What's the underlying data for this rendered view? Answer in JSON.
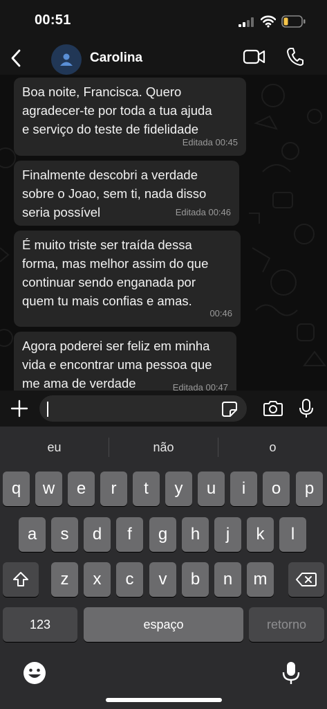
{
  "status_bar": {
    "time": "00:51"
  },
  "header": {
    "contact_name": "Carolina"
  },
  "messages": [
    {
      "text": "Boa noite, Francisca. Quero\nagradecer-te por toda a tua ajuda\ne serviço do teste de fidelidade",
      "meta": "Editada 00:45"
    },
    {
      "text": "Finalmente descobri a verdade\nsobre o Joao, sem ti, nada disso\nseria possível",
      "meta": "Editada 00:46"
    },
    {
      "text": "É muito triste ser traída dessa\nforma, mas melhor assim do que\ncontinuar sendo enganada por\nquem tu mais confias e amas.",
      "meta": "00:46"
    },
    {
      "text": "Agora poderei ser feliz em minha\nvida e encontrar uma pessoa que\nme ama de verdade",
      "meta": "Editada 00:47"
    }
  ],
  "input": {
    "value": ""
  },
  "keyboard": {
    "suggestions": [
      "eu",
      "não",
      "o"
    ],
    "row1": [
      "q",
      "w",
      "e",
      "r",
      "t",
      "y",
      "u",
      "i",
      "o",
      "p"
    ],
    "row2": [
      "a",
      "s",
      "d",
      "f",
      "g",
      "h",
      "j",
      "k",
      "l"
    ],
    "row3": [
      "z",
      "x",
      "c",
      "v",
      "b",
      "n",
      "m"
    ],
    "numbers_key": "123",
    "space_key": "espaço",
    "return_key": "retorno"
  },
  "colors": {
    "avatar_bg": "#213756",
    "avatar_icon": "#5a8fd6",
    "battery_fill": "#f6c54a",
    "bubble_bg": "#262626"
  }
}
